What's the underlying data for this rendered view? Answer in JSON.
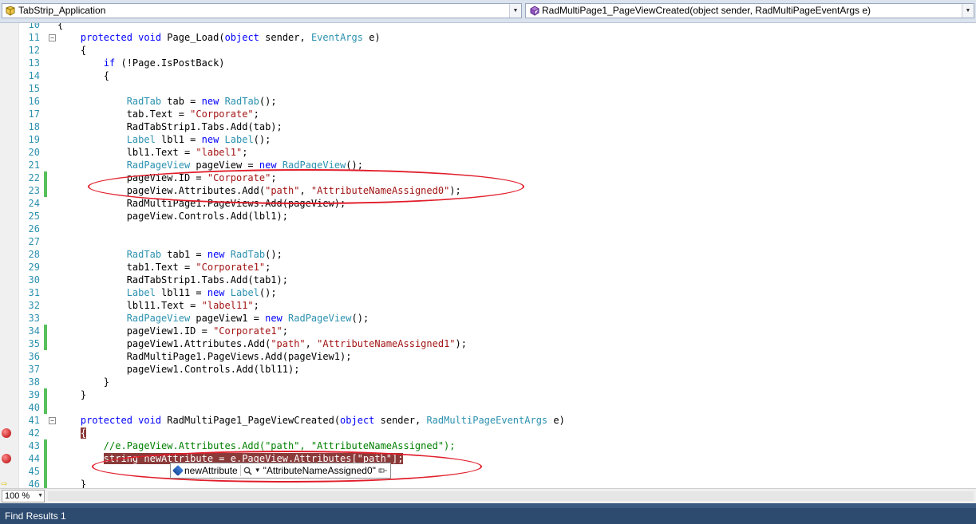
{
  "nav": {
    "project": "TabStrip_Application",
    "member": "RadMultiPage1_PageViewCreated(object sender, RadMultiPageEventArgs e)"
  },
  "editor": {
    "lines": [
      {
        "n": "10",
        "segs": [
          {
            "t": "{"
          }
        ]
      },
      {
        "n": "11",
        "fold": true,
        "segs": [
          {
            "t": "    "
          },
          {
            "t": "protected",
            "c": "kw"
          },
          {
            "t": " "
          },
          {
            "t": "void",
            "c": "kw"
          },
          {
            "t": " Page_Load("
          },
          {
            "t": "object",
            "c": "kw"
          },
          {
            "t": " sender, "
          },
          {
            "t": "EventArgs",
            "c": "ty"
          },
          {
            "t": " e)"
          }
        ]
      },
      {
        "n": "12",
        "segs": [
          {
            "t": "    {"
          }
        ]
      },
      {
        "n": "13",
        "segs": [
          {
            "t": "        "
          },
          {
            "t": "if",
            "c": "kw"
          },
          {
            "t": " (!Page.IsPostBack)"
          }
        ]
      },
      {
        "n": "14",
        "segs": [
          {
            "t": "        {"
          }
        ]
      },
      {
        "n": "15",
        "segs": []
      },
      {
        "n": "16",
        "segs": [
          {
            "t": "            "
          },
          {
            "t": "RadTab",
            "c": "ty"
          },
          {
            "t": " tab = "
          },
          {
            "t": "new",
            "c": "kw"
          },
          {
            "t": " "
          },
          {
            "t": "RadTab",
            "c": "ty"
          },
          {
            "t": "();"
          }
        ]
      },
      {
        "n": "17",
        "segs": [
          {
            "t": "            tab.Text = "
          },
          {
            "t": "\"Corporate\"",
            "c": "st"
          },
          {
            "t": ";"
          }
        ]
      },
      {
        "n": "18",
        "segs": [
          {
            "t": "            RadTabStrip1.Tabs.Add(tab);"
          }
        ]
      },
      {
        "n": "19",
        "segs": [
          {
            "t": "            "
          },
          {
            "t": "Label",
            "c": "ty"
          },
          {
            "t": " lbl1 = "
          },
          {
            "t": "new",
            "c": "kw"
          },
          {
            "t": " "
          },
          {
            "t": "Label",
            "c": "ty"
          },
          {
            "t": "();"
          }
        ]
      },
      {
        "n": "20",
        "segs": [
          {
            "t": "            lbl1.Text = "
          },
          {
            "t": "\"label1\"",
            "c": "st"
          },
          {
            "t": ";"
          }
        ]
      },
      {
        "n": "21",
        "segs": [
          {
            "t": "            "
          },
          {
            "t": "RadPageView",
            "c": "ty"
          },
          {
            "t": " pageView = "
          },
          {
            "t": "new",
            "c": "kw"
          },
          {
            "t": " "
          },
          {
            "t": "RadPageView",
            "c": "ty"
          },
          {
            "t": "();"
          }
        ]
      },
      {
        "n": "22",
        "changed": true,
        "segs": [
          {
            "t": "            pageView.ID = "
          },
          {
            "t": "\"Corporate\"",
            "c": "st"
          },
          {
            "t": ";"
          }
        ]
      },
      {
        "n": "23",
        "changed": true,
        "segs": [
          {
            "t": "            pageView.Attributes.Add("
          },
          {
            "t": "\"path\"",
            "c": "st"
          },
          {
            "t": ", "
          },
          {
            "t": "\"AttributeNameAssigned0\"",
            "c": "st"
          },
          {
            "t": ");"
          }
        ]
      },
      {
        "n": "24",
        "segs": [
          {
            "t": "            RadMultiPage1.PageViews.Add(pageView);"
          }
        ]
      },
      {
        "n": "25",
        "segs": [
          {
            "t": "            pageView.Controls.Add(lbl1);"
          }
        ]
      },
      {
        "n": "26",
        "segs": []
      },
      {
        "n": "27",
        "segs": []
      },
      {
        "n": "28",
        "segs": [
          {
            "t": "            "
          },
          {
            "t": "RadTab",
            "c": "ty"
          },
          {
            "t": " tab1 = "
          },
          {
            "t": "new",
            "c": "kw"
          },
          {
            "t": " "
          },
          {
            "t": "RadTab",
            "c": "ty"
          },
          {
            "t": "();"
          }
        ]
      },
      {
        "n": "29",
        "segs": [
          {
            "t": "            tab1.Text = "
          },
          {
            "t": "\"Corporate1\"",
            "c": "st"
          },
          {
            "t": ";"
          }
        ]
      },
      {
        "n": "30",
        "segs": [
          {
            "t": "            RadTabStrip1.Tabs.Add(tab1);"
          }
        ]
      },
      {
        "n": "31",
        "segs": [
          {
            "t": "            "
          },
          {
            "t": "Label",
            "c": "ty"
          },
          {
            "t": " lbl11 = "
          },
          {
            "t": "new",
            "c": "kw"
          },
          {
            "t": " "
          },
          {
            "t": "Label",
            "c": "ty"
          },
          {
            "t": "();"
          }
        ]
      },
      {
        "n": "32",
        "segs": [
          {
            "t": "            lbl11.Text = "
          },
          {
            "t": "\"label11\"",
            "c": "st"
          },
          {
            "t": ";"
          }
        ]
      },
      {
        "n": "33",
        "segs": [
          {
            "t": "            "
          },
          {
            "t": "RadPageView",
            "c": "ty"
          },
          {
            "t": " pageView1 = "
          },
          {
            "t": "new",
            "c": "kw"
          },
          {
            "t": " "
          },
          {
            "t": "RadPageView",
            "c": "ty"
          },
          {
            "t": "();"
          }
        ]
      },
      {
        "n": "34",
        "changed": true,
        "segs": [
          {
            "t": "            pageView1.ID = "
          },
          {
            "t": "\"Corporate1\"",
            "c": "st"
          },
          {
            "t": ";"
          }
        ]
      },
      {
        "n": "35",
        "changed": true,
        "segs": [
          {
            "t": "            pageView1.Attributes.Add("
          },
          {
            "t": "\"path\"",
            "c": "st"
          },
          {
            "t": ", "
          },
          {
            "t": "\"AttributeNameAssigned1\"",
            "c": "st"
          },
          {
            "t": ");"
          }
        ]
      },
      {
        "n": "36",
        "segs": [
          {
            "t": "            RadMultiPage1.PageViews.Add(pageView1);"
          }
        ]
      },
      {
        "n": "37",
        "segs": [
          {
            "t": "            pageView1.Controls.Add(lbl11);"
          }
        ]
      },
      {
        "n": "38",
        "segs": [
          {
            "t": "        }"
          }
        ]
      },
      {
        "n": "39",
        "changed": true,
        "segs": [
          {
            "t": "    }"
          }
        ]
      },
      {
        "n": "40",
        "changed": true,
        "segs": []
      },
      {
        "n": "41",
        "fold": true,
        "segs": [
          {
            "t": "    "
          },
          {
            "t": "protected",
            "c": "kw"
          },
          {
            "t": " "
          },
          {
            "t": "void",
            "c": "kw"
          },
          {
            "t": " RadMultiPage1_PageViewCreated("
          },
          {
            "t": "object",
            "c": "kw"
          },
          {
            "t": " sender, "
          },
          {
            "t": "RadMultiPageEventArgs",
            "c": "ty"
          },
          {
            "t": " e)"
          }
        ]
      },
      {
        "n": "42",
        "bp": true,
        "segs": [
          {
            "t": "    "
          },
          {
            "t": "{",
            "c": "hl"
          }
        ]
      },
      {
        "n": "43",
        "changed": true,
        "segs": [
          {
            "t": "        "
          },
          {
            "t": "//e.PageView.Attributes.Add(\"path\", \"AttributeNameAssigned\");",
            "c": "cm"
          }
        ]
      },
      {
        "n": "44",
        "bp": true,
        "changed": true,
        "segs": [
          {
            "t": "        "
          },
          {
            "t": "string newAttribute = e.PageView.Attributes[\"path\"];",
            "c": "hl"
          }
        ]
      },
      {
        "n": "45",
        "changed": true,
        "segs": []
      },
      {
        "n": "46",
        "ptr": true,
        "changed": true,
        "segs": [
          {
            "t": "    }"
          }
        ]
      }
    ]
  },
  "datatip": {
    "name": "newAttribute",
    "value": "\"AttributeNameAssigned0\""
  },
  "status": {
    "zoom": "100 %"
  },
  "tool_window": {
    "tab": "Find Results 1"
  },
  "colors": {
    "callout": "#e11d2a",
    "highlight": "#8b3a3a",
    "toolbar": "#2d4a6f"
  }
}
